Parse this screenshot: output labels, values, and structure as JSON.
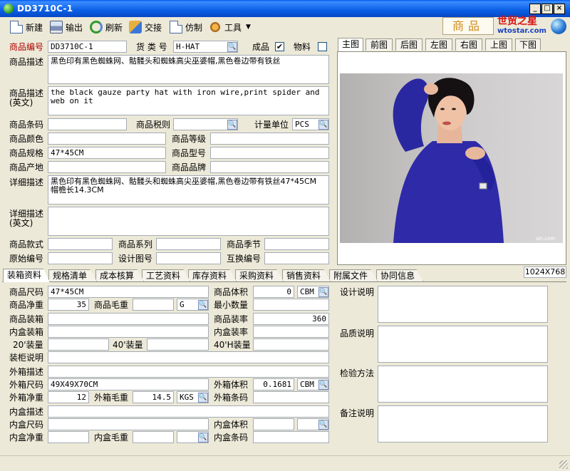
{
  "window": {
    "title": "DD3710C-1"
  },
  "toolbar": {
    "new": "新建",
    "export": "输出",
    "refresh": "刷新",
    "exchange": "交接",
    "imitate": "仿制",
    "tools": "工具"
  },
  "brand": {
    "badge": "商品",
    "logo_cn": "世贸之星",
    "logo_url": "wtostar.com"
  },
  "form": {
    "product_no_label": "商品编号",
    "product_no": "DD3710C-1",
    "category_label": "货 类 号",
    "category": "H-HAT",
    "finished_label": "成品",
    "finished_checked": "✔",
    "material_label": "物料",
    "desc_label": "商品描述",
    "desc": "黑色印有黑色蜘蛛网、骷髅头和蜘蛛高尖巫婆帽,黑色卷边带有铁丝",
    "desc_en_label": "商品描述",
    "desc_en_label2": "(英文)",
    "desc_en": "the black gauze party hat with iron wire,print spider and web on it",
    "barcode_label": "商品条码",
    "tax_label": "商品税则",
    "unit_label": "计量单位",
    "unit": "PCS",
    "color_label": "商品颜色",
    "grade_label": "商品等级",
    "spec_label": "商品规格",
    "spec": "47*45CM",
    "model_label": "商品型号",
    "origin_label": "商品产地",
    "brand_label": "商品品牌",
    "detail_label": "详细描述",
    "detail": "黑色印有黑色蜘蛛网、骷髅头和蜘蛛高尖巫婆帽,黑色卷边带有铁丝47*45CM 帽檐长14.3CM",
    "detail_en_label": "详细描述",
    "detail_en_label2": "(英文)",
    "style_label": "商品款式",
    "series_label": "商品系列",
    "season_label": "商品季节",
    "orig_no_label": "原始编号",
    "design_no_label": "设计图号",
    "swap_no_label": "互换编号"
  },
  "image_tabs": [
    "主图",
    "前图",
    "后图",
    "左图",
    "右图",
    "上图",
    "下图"
  ],
  "image": {
    "resolution": "1024X768",
    "watermark": "sin.com"
  },
  "bottom_tabs": [
    "装箱资料",
    "规格清单",
    "成本核算",
    "工艺资料",
    "库存资料",
    "采购资料",
    "销售资料",
    "附属文件",
    "协同信息"
  ],
  "packing": {
    "size_label": "商品尺码",
    "size": "47*45CM",
    "volume_label": "商品体积",
    "volume": "0",
    "volume_unit": "CBM",
    "net_label": "商品净重",
    "net": "35",
    "gross_label": "商品毛重",
    "weight_unit": "G",
    "min_qty_label": "最小数量",
    "pack_label": "商品装箱",
    "pack_rate_label": "商品装率",
    "pack_rate": "360",
    "inner_pack_label": "内盒装箱",
    "inner_rate_label": "内盒装率",
    "c20_label": "20'装量",
    "c40_label": "40'装量",
    "c40h_label": "40'H装量",
    "load_note_label": "装柜说明",
    "outer_desc_label": "外箱描述",
    "outer_size_label": "外箱尺码",
    "outer_size": "49X49X70CM",
    "outer_vol_label": "外箱体积",
    "outer_vol": "0.1681",
    "outer_vol_unit": "CBM",
    "outer_net_label": "外箱净重",
    "outer_net": "12",
    "outer_gross_label": "外箱毛重",
    "outer_gross": "14.5",
    "outer_gross_unit": "KGS",
    "outer_barcode_label": "外箱条码",
    "inner_desc_label": "内盒描述",
    "inner_size_label": "内盒尺码",
    "inner_vol_label": "内盒体积",
    "inner_net_label": "内盒净重",
    "inner_gross_label": "内盒毛重",
    "inner_barcode_label": "内盒条码",
    "design_note_label": "设计说明",
    "quality_note_label": "品质说明",
    "inspect_label": "检验方法",
    "remark_label": "备注说明"
  }
}
